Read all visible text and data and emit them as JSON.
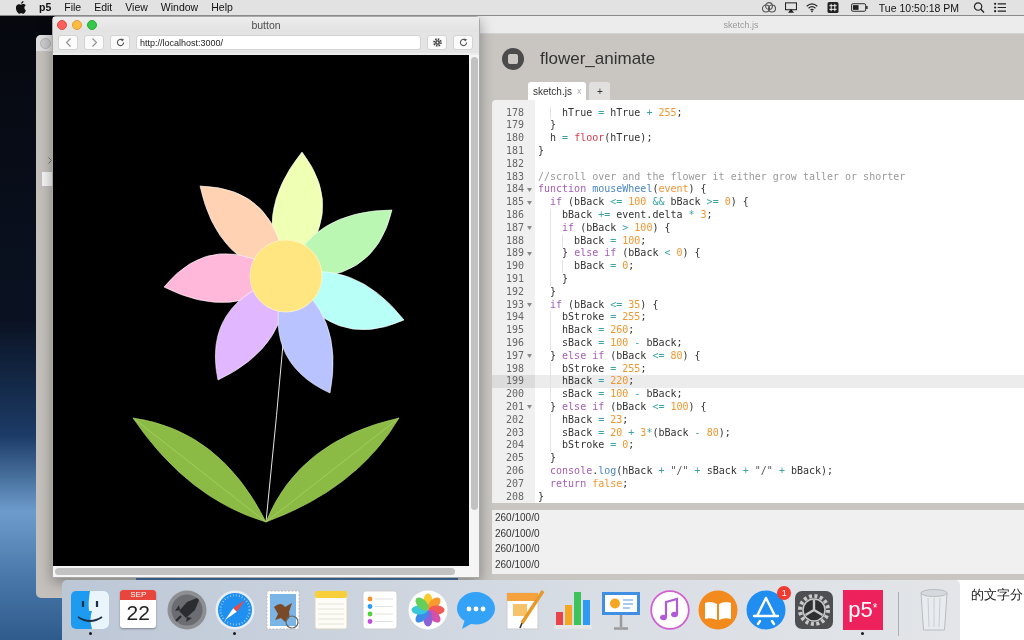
{
  "menu_bar": {
    "app_name": "p5",
    "menus": [
      "File",
      "Edit",
      "View",
      "Window",
      "Help"
    ],
    "clock": "Tue 10:50:18 PM"
  },
  "browser": {
    "title": "button",
    "url": "http://localhost:3000/"
  },
  "editor": {
    "title": "sketch.js",
    "sketch_name": "flower_animate",
    "tabs": [
      {
        "label": "sketch.js",
        "close": "x",
        "selected": true
      },
      {
        "label": "+",
        "selected": false
      }
    ],
    "code_lines": [
      {
        "number": "178",
        "foldable": false,
        "current": false,
        "tokens": [
          {
            "kind": "plain",
            "text": "    hTrue "
          },
          {
            "kind": "operator",
            "text": "="
          },
          {
            "kind": "plain",
            "text": " hTrue "
          },
          {
            "kind": "operator",
            "text": "+"
          },
          {
            "kind": "number",
            "text": " 255"
          },
          {
            "kind": "plain",
            "text": ";"
          }
        ]
      },
      {
        "number": "179",
        "foldable": false,
        "current": false,
        "tokens": [
          {
            "kind": "plain",
            "text": "  }"
          }
        ]
      },
      {
        "number": "180",
        "foldable": false,
        "current": false,
        "tokens": [
          {
            "kind": "plain",
            "text": "  h "
          },
          {
            "kind": "operator",
            "text": "="
          },
          {
            "kind": "builtin",
            "text": " floor"
          },
          {
            "kind": "plain",
            "text": "(hTrue);"
          }
        ]
      },
      {
        "number": "181",
        "foldable": false,
        "current": false,
        "tokens": [
          {
            "kind": "plain",
            "text": "}"
          }
        ]
      },
      {
        "number": "182",
        "foldable": false,
        "current": false
      },
      {
        "number": "183",
        "foldable": false,
        "current": false,
        "tokens": [
          {
            "kind": "comment",
            "text": "//scroll over and the flower it either grow taller or shorter"
          }
        ]
      },
      {
        "number": "184",
        "foldable": true,
        "current": false,
        "tokens": [
          {
            "kind": "keyword",
            "text": "function"
          },
          {
            "kind": "function",
            "text": " mouseWheel"
          },
          {
            "kind": "plain",
            "text": "("
          },
          {
            "kind": "param",
            "text": "event"
          },
          {
            "kind": "plain",
            "text": ") {"
          }
        ]
      },
      {
        "number": "185",
        "foldable": true,
        "current": false,
        "tokens": [
          {
            "kind": "keyword",
            "text": "  if"
          },
          {
            "kind": "plain",
            "text": " (bBack "
          },
          {
            "kind": "operator",
            "text": "<="
          },
          {
            "kind": "number",
            "text": " 100"
          },
          {
            "kind": "operator",
            "text": " &&"
          },
          {
            "kind": "plain",
            "text": " bBack "
          },
          {
            "kind": "operator",
            "text": ">="
          },
          {
            "kind": "number",
            "text": " 0"
          },
          {
            "kind": "plain",
            "text": ") {"
          }
        ]
      },
      {
        "number": "186",
        "foldable": false,
        "current": false,
        "tokens": [
          {
            "kind": "plain",
            "text": "    bBack "
          },
          {
            "kind": "operator",
            "text": "+="
          },
          {
            "kind": "plain",
            "text": " event.delta "
          },
          {
            "kind": "operator",
            "text": "*"
          },
          {
            "kind": "number",
            "text": " 3"
          },
          {
            "kind": "plain",
            "text": ";"
          }
        ]
      },
      {
        "number": "187",
        "foldable": true,
        "current": false,
        "tokens": [
          {
            "kind": "keyword",
            "text": "    if"
          },
          {
            "kind": "plain",
            "text": " (bBack "
          },
          {
            "kind": "operator",
            "text": ">"
          },
          {
            "kind": "number",
            "text": " 100"
          },
          {
            "kind": "plain",
            "text": ") {"
          }
        ]
      },
      {
        "number": "188",
        "foldable": false,
        "current": false,
        "tokens": [
          {
            "kind": "plain",
            "text": "      bBack "
          },
          {
            "kind": "operator",
            "text": "="
          },
          {
            "kind": "number",
            "text": " 100"
          },
          {
            "kind": "plain",
            "text": ";"
          }
        ]
      },
      {
        "number": "189",
        "foldable": true,
        "current": false,
        "tokens": [
          {
            "kind": "plain",
            "text": "    } "
          },
          {
            "kind": "keyword",
            "text": "else"
          },
          {
            "kind": "keyword",
            "text": " if"
          },
          {
            "kind": "plain",
            "text": " (bBack "
          },
          {
            "kind": "operator",
            "text": "<"
          },
          {
            "kind": "number",
            "text": " 0"
          },
          {
            "kind": "plain",
            "text": ") {"
          }
        ]
      },
      {
        "number": "190",
        "foldable": false,
        "current": false,
        "tokens": [
          {
            "kind": "plain",
            "text": "      bBack "
          },
          {
            "kind": "operator",
            "text": "="
          },
          {
            "kind": "number",
            "text": " 0"
          },
          {
            "kind": "plain",
            "text": ";"
          }
        ]
      },
      {
        "number": "191",
        "foldable": false,
        "current": false,
        "tokens": [
          {
            "kind": "plain",
            "text": "    }"
          }
        ]
      },
      {
        "number": "192",
        "foldable": false,
        "current": false,
        "tokens": [
          {
            "kind": "plain",
            "text": "  }"
          }
        ]
      },
      {
        "number": "193",
        "foldable": true,
        "current": false,
        "tokens": [
          {
            "kind": "keyword",
            "text": "  if"
          },
          {
            "kind": "plain",
            "text": " (bBack "
          },
          {
            "kind": "operator",
            "text": "<="
          },
          {
            "kind": "number",
            "text": " 35"
          },
          {
            "kind": "plain",
            "text": ") {"
          }
        ]
      },
      {
        "number": "194",
        "foldable": false,
        "current": false,
        "tokens": [
          {
            "kind": "plain",
            "text": "    bStroke "
          },
          {
            "kind": "operator",
            "text": "="
          },
          {
            "kind": "number",
            "text": " 255"
          },
          {
            "kind": "plain",
            "text": ";"
          }
        ]
      },
      {
        "number": "195",
        "foldable": false,
        "current": false,
        "tokens": [
          {
            "kind": "plain",
            "text": "    hBack "
          },
          {
            "kind": "operator",
            "text": "="
          },
          {
            "kind": "number",
            "text": " 260"
          },
          {
            "kind": "plain",
            "text": ";"
          }
        ]
      },
      {
        "number": "196",
        "foldable": false,
        "current": false,
        "tokens": [
          {
            "kind": "plain",
            "text": "    sBack "
          },
          {
            "kind": "operator",
            "text": "="
          },
          {
            "kind": "number",
            "text": " 100"
          },
          {
            "kind": "operator",
            "text": " -"
          },
          {
            "kind": "plain",
            "text": " bBack;"
          }
        ]
      },
      {
        "number": "197",
        "foldable": true,
        "current": false,
        "tokens": [
          {
            "kind": "plain",
            "text": "  } "
          },
          {
            "kind": "keyword",
            "text": "else"
          },
          {
            "kind": "keyword",
            "text": " if"
          },
          {
            "kind": "plain",
            "text": " (bBack "
          },
          {
            "kind": "operator",
            "text": "<="
          },
          {
            "kind": "number",
            "text": " 80"
          },
          {
            "kind": "plain",
            "text": ") {"
          }
        ]
      },
      {
        "number": "198",
        "foldable": false,
        "current": false,
        "tokens": [
          {
            "kind": "plain",
            "text": "    bStroke "
          },
          {
            "kind": "operator",
            "text": "="
          },
          {
            "kind": "number",
            "text": " 255"
          },
          {
            "kind": "plain",
            "text": ";"
          }
        ]
      },
      {
        "number": "199",
        "foldable": false,
        "current": true,
        "tokens": [
          {
            "kind": "plain",
            "text": "    hBack "
          },
          {
            "kind": "operator",
            "text": "="
          },
          {
            "kind": "number",
            "text": " 220"
          },
          {
            "kind": "plain",
            "text": ";"
          }
        ]
      },
      {
        "number": "200",
        "foldable": false,
        "current": false,
        "tokens": [
          {
            "kind": "plain",
            "text": "    sBack "
          },
          {
            "kind": "operator",
            "text": "="
          },
          {
            "kind": "number",
            "text": " 100"
          },
          {
            "kind": "operator",
            "text": " -"
          },
          {
            "kind": "plain",
            "text": " bBack;"
          }
        ]
      },
      {
        "number": "201",
        "foldable": true,
        "current": false,
        "tokens": [
          {
            "kind": "plain",
            "text": "  } "
          },
          {
            "kind": "keyword",
            "text": "else"
          },
          {
            "kind": "keyword",
            "text": " if"
          },
          {
            "kind": "plain",
            "text": " (bBack "
          },
          {
            "kind": "operator",
            "text": "<="
          },
          {
            "kind": "number",
            "text": " 100"
          },
          {
            "kind": "plain",
            "text": ") {"
          }
        ]
      },
      {
        "number": "202",
        "foldable": false,
        "current": false,
        "tokens": [
          {
            "kind": "plain",
            "text": "    hBack "
          },
          {
            "kind": "operator",
            "text": "="
          },
          {
            "kind": "number",
            "text": " 23"
          },
          {
            "kind": "plain",
            "text": ";"
          }
        ]
      },
      {
        "number": "203",
        "foldable": false,
        "current": false,
        "tokens": [
          {
            "kind": "plain",
            "text": "    sBack "
          },
          {
            "kind": "operator",
            "text": "="
          },
          {
            "kind": "number",
            "text": " 20"
          },
          {
            "kind": "operator",
            "text": " +"
          },
          {
            "kind": "number",
            "text": " 3"
          },
          {
            "kind": "operator",
            "text": "*"
          },
          {
            "kind": "plain",
            "text": "(bBack "
          },
          {
            "kind": "operator",
            "text": "-"
          },
          {
            "kind": "number",
            "text": " 80"
          },
          {
            "kind": "plain",
            "text": ");"
          }
        ]
      },
      {
        "number": "204",
        "foldable": false,
        "current": false,
        "tokens": [
          {
            "kind": "plain",
            "text": "    bStroke "
          },
          {
            "kind": "operator",
            "text": "="
          },
          {
            "kind": "number",
            "text": " 0"
          },
          {
            "kind": "plain",
            "text": ";"
          }
        ]
      },
      {
        "number": "205",
        "foldable": false,
        "current": false,
        "tokens": [
          {
            "kind": "plain",
            "text": "  }"
          }
        ]
      },
      {
        "number": "206",
        "foldable": false,
        "current": false,
        "tokens": [
          {
            "kind": "keyword",
            "text": "  console"
          },
          {
            "kind": "plain",
            "text": "."
          },
          {
            "kind": "function",
            "text": "log"
          },
          {
            "kind": "plain",
            "text": "(hBack "
          },
          {
            "kind": "operator",
            "text": "+"
          },
          {
            "kind": "string",
            "text": " \"/\""
          },
          {
            "kind": "operator",
            "text": " +"
          },
          {
            "kind": "plain",
            "text": " sBack "
          },
          {
            "kind": "operator",
            "text": "+"
          },
          {
            "kind": "string",
            "text": " \"/\""
          },
          {
            "kind": "operator",
            "text": " +"
          },
          {
            "kind": "plain",
            "text": " bBack);"
          }
        ]
      },
      {
        "number": "207",
        "foldable": false,
        "current": false,
        "tokens": [
          {
            "kind": "keyword",
            "text": "  return"
          },
          {
            "kind": "constant",
            "text": " false"
          },
          {
            "kind": "plain",
            "text": ";"
          }
        ]
      },
      {
        "number": "208",
        "foldable": false,
        "current": false,
        "tokens": [
          {
            "kind": "plain",
            "text": "}"
          }
        ]
      }
    ],
    "console": [
      "260/100/0",
      "260/100/0",
      "260/100/0",
      "260/100/0"
    ]
  },
  "dock": {
    "apps": [
      {
        "kind": "finder",
        "running": true
      },
      {
        "kind": "calendar",
        "month": "SEP",
        "day": "22",
        "running": false
      },
      {
        "kind": "launchpad",
        "running": false
      },
      {
        "kind": "safari",
        "running": true
      },
      {
        "kind": "mail",
        "running": false
      },
      {
        "kind": "notes",
        "running": false
      },
      {
        "kind": "reminders",
        "running": false
      },
      {
        "kind": "photos",
        "running": false
      },
      {
        "kind": "messages",
        "running": false
      },
      {
        "kind": "pages",
        "running": false
      },
      {
        "kind": "numbers",
        "running": false
      },
      {
        "kind": "keynote",
        "running": false
      },
      {
        "kind": "music",
        "running": false
      },
      {
        "kind": "books",
        "running": false
      },
      {
        "kind": "app_store",
        "badge": "1",
        "running": false
      },
      {
        "kind": "preferences",
        "running": false
      },
      {
        "kind": "p5",
        "label": "p5$^{*}$",
        "running": true
      }
    ],
    "trash_section": [
      {
        "kind": "trash"
      }
    ]
  },
  "background_document": {
    "text": "的文字分"
  }
}
